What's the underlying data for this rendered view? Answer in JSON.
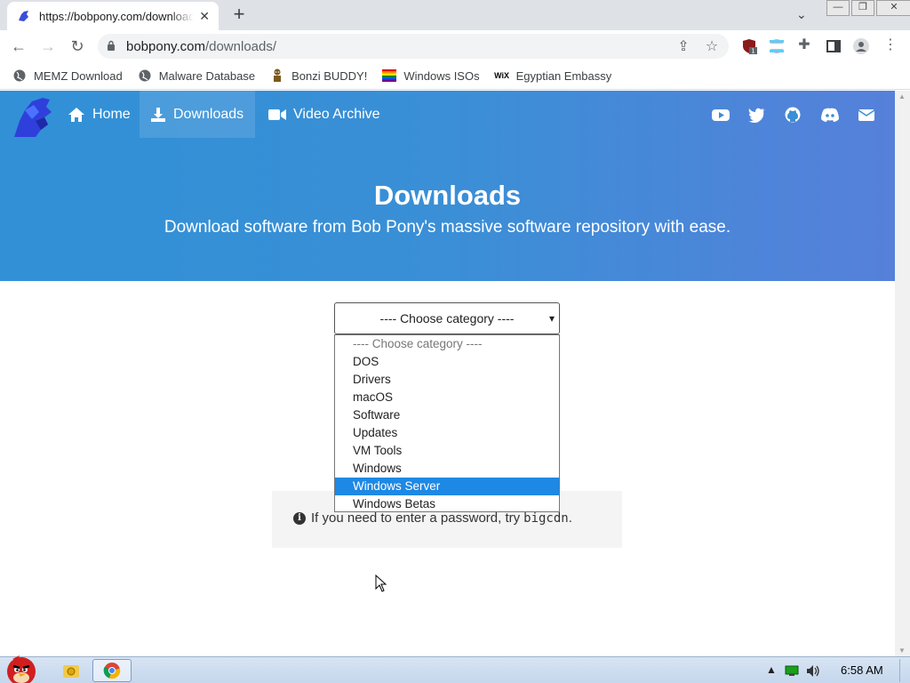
{
  "browser": {
    "tab_title": "https://bobpony.com/downloads/",
    "new_tab_label": "+",
    "close_tab_label": "✕",
    "url_host": "bobpony.com",
    "url_path": "/downloads/"
  },
  "bookmarks": [
    {
      "label": "MEMZ Download",
      "icon": "globe-icon"
    },
    {
      "label": "Malware Database",
      "icon": "globe-icon"
    },
    {
      "label": "Bonzi BUDDY!",
      "icon": "bonzi-icon"
    },
    {
      "label": "Windows ISOs",
      "icon": "rainbow-flag-icon"
    },
    {
      "label": "Egyptian Embassy",
      "icon": "wix-icon"
    }
  ],
  "site_nav": {
    "home": "Home",
    "downloads": "Downloads",
    "video_archive": "Video Archive"
  },
  "hero": {
    "title": "Downloads",
    "subtitle": "Download software from Bob Pony's massive software repository with ease."
  },
  "category_select": {
    "selected": "---- Choose category ----",
    "options": [
      "---- Choose category ----",
      "DOS",
      "Drivers",
      "macOS",
      "Software",
      "Updates",
      "VM Tools",
      "Windows",
      "Windows Server",
      "Windows Betas"
    ],
    "highlighted": "Windows Server"
  },
  "notice": {
    "text": "If you need to enter a password, try",
    "password": "bigcdn",
    "suffix": "."
  },
  "taskbar": {
    "clock": "6:58 AM"
  },
  "colors": {
    "hero_start": "#3190d6",
    "hero_end": "#5680da",
    "selected_option": "#1e88e5"
  }
}
